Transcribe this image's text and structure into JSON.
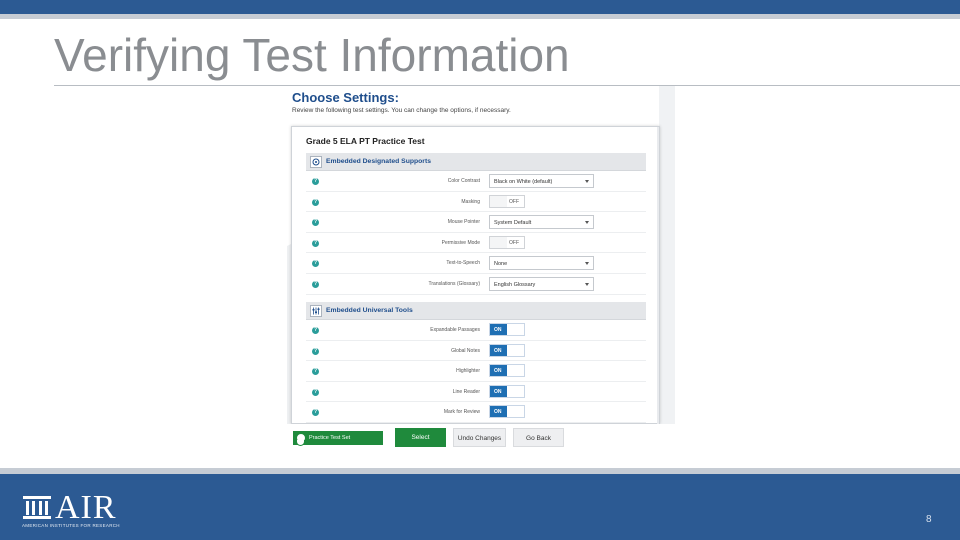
{
  "slide": {
    "title": "Verifying Test Information",
    "page_number": "8"
  },
  "footer": {
    "logo_word": "AIR",
    "logo_tagline": "AMERICAN INSTITUTES FOR RESEARCH"
  },
  "settings": {
    "heading": "Choose Settings:",
    "subheading": "Review the following test settings. You can change the options, if necessary.",
    "test_name": "Grade 5 ELA PT Practice Test",
    "sections": [
      {
        "label": "Embedded Designated Supports",
        "icon": "target-icon",
        "rows": [
          {
            "label": "Color Contrast",
            "kind": "select",
            "value": "Black on White (default)"
          },
          {
            "label": "Masking",
            "kind": "toggle",
            "value": "OFF"
          },
          {
            "label": "Mouse Pointer",
            "kind": "select",
            "value": "System Default"
          },
          {
            "label": "Permissive Mode",
            "kind": "toggle",
            "value": "OFF"
          },
          {
            "label": "Text-to-Speech",
            "kind": "select",
            "value": "None"
          },
          {
            "label": "Translations (Glossary)",
            "kind": "select",
            "value": "English Glossary"
          }
        ]
      },
      {
        "label": "Embedded Universal Tools",
        "icon": "sliders-icon",
        "rows": [
          {
            "label": "Expandable Passages",
            "kind": "toggle",
            "value": "ON"
          },
          {
            "label": "Global Notes",
            "kind": "toggle",
            "value": "ON"
          },
          {
            "label": "Highlighter",
            "kind": "toggle",
            "value": "ON"
          },
          {
            "label": "Line Reader",
            "kind": "toggle",
            "value": "ON"
          },
          {
            "label": "Mark for Review",
            "kind": "toggle",
            "value": "ON"
          }
        ]
      }
    ],
    "status_text": "Practice Test Set",
    "buttons": {
      "select": "Select",
      "undo": "Undo Changes",
      "go_back": "Go Back"
    }
  },
  "colors": {
    "brand_blue": "#2c5a93",
    "link_blue": "#1f4e8c",
    "toggle_on": "#1f6fb3",
    "action_green": "#1f8a3c",
    "help_teal": "#2a9d9a"
  }
}
